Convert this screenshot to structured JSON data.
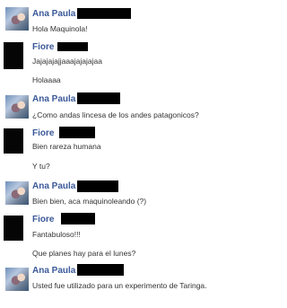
{
  "conversation": [
    {
      "sender": "Ana Paula",
      "avatar": "profile-photo",
      "messages": [
        "Hola Maquinola!"
      ]
    },
    {
      "sender": "Fiore",
      "avatar": "black-avatar",
      "messages": [
        "Jajajajajjaaajajajajaa",
        "Holaaaa"
      ]
    },
    {
      "sender": "Ana Paula",
      "avatar": "profile-photo",
      "messages": [
        "¿Como andas lincesa de los andes patagonicos?"
      ]
    },
    {
      "sender": "Fiore",
      "avatar": "black-avatar",
      "messages": [
        "Bien rareza humana",
        "Y tu?"
      ]
    },
    {
      "sender": "Ana Paula",
      "avatar": "profile-photo",
      "messages": [
        "Bien bien, aca  maquinoleando (?)"
      ]
    },
    {
      "sender": "Fiore",
      "avatar": "black-avatar",
      "messages": [
        "Fantabuloso!!!",
        "Que planes hay para el lunes?"
      ]
    },
    {
      "sender": "Ana Paula",
      "avatar": "profile-photo",
      "messages": [
        "Usted fue utilizado para un experimento de Taringa."
      ]
    }
  ],
  "colors": {
    "sender_name": "#3b5998",
    "message_text": "#333333",
    "redaction": "#000000"
  }
}
